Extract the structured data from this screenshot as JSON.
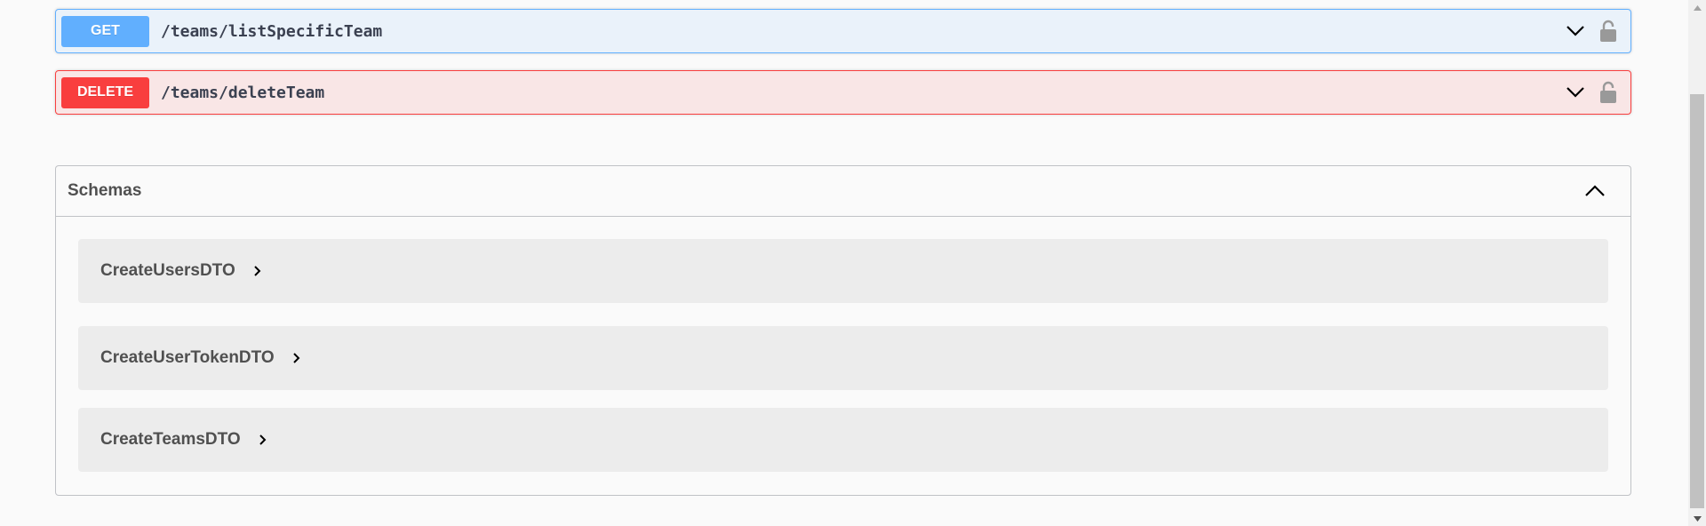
{
  "operations": [
    {
      "method": "GET",
      "path": "/teams/listSpecificTeam",
      "color": "#61affe"
    },
    {
      "method": "DELETE",
      "path": "/teams/deleteTeam",
      "color": "#f93e3e"
    }
  ],
  "schemas": {
    "title": "Schemas",
    "items": [
      {
        "name": "CreateUsersDTO"
      },
      {
        "name": "CreateUserTokenDTO"
      },
      {
        "name": "CreateTeamsDTO"
      }
    ]
  },
  "icons": {
    "expand": "chevron-down-icon",
    "lock": "unlocked-padlock-icon",
    "collapse": "chevron-up-icon",
    "model_expand": "chevron-right-icon"
  }
}
